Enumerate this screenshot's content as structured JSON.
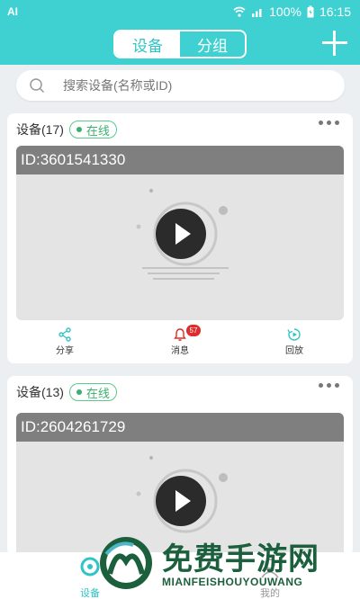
{
  "status_bar": {
    "app_label": "AI",
    "battery": "100%",
    "time": "16:15"
  },
  "header": {
    "tabs": [
      {
        "label": "设备",
        "active": true
      },
      {
        "label": "分组",
        "active": false
      }
    ],
    "add_icon": "plus-icon"
  },
  "search": {
    "placeholder": "搜索设备(名称或ID)",
    "value": ""
  },
  "devices": [
    {
      "title": "设备(17)",
      "status": "在线",
      "id_label": "ID:3601541330",
      "actions": [
        {
          "label": "分享",
          "icon": "share-icon"
        },
        {
          "label": "消息",
          "icon": "bell-icon",
          "badge": "57"
        },
        {
          "label": "回放",
          "icon": "playback-icon"
        }
      ]
    },
    {
      "title": "设备(13)",
      "status": "在线",
      "id_label": "ID:2604261729"
    }
  ],
  "bottom_nav": [
    {
      "label": "设备",
      "active": true
    },
    {
      "label": "我的",
      "active": false
    }
  ],
  "watermark": {
    "text": "免费手游网",
    "sub": "MIANFEISHOUYOUWANG"
  },
  "colors": {
    "accent": "#3fd1d2",
    "online": "#3bb06e",
    "badge": "#e02b2b",
    "id_bar": "#7f7f7f",
    "watermark": "#1b5f3c"
  }
}
